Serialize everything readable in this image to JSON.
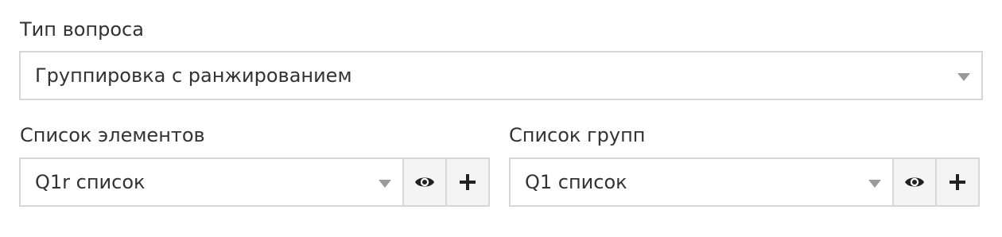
{
  "question_type": {
    "label": "Тип вопроса",
    "selected": "Группировка с ранжированием"
  },
  "elements_list": {
    "label": "Список элементов",
    "selected": "Q1r список",
    "view_icon": "eye-icon",
    "add_icon": "plus-icon"
  },
  "groups_list": {
    "label": "Список групп",
    "selected": "Q1 список",
    "view_icon": "eye-icon",
    "add_icon": "plus-icon"
  }
}
